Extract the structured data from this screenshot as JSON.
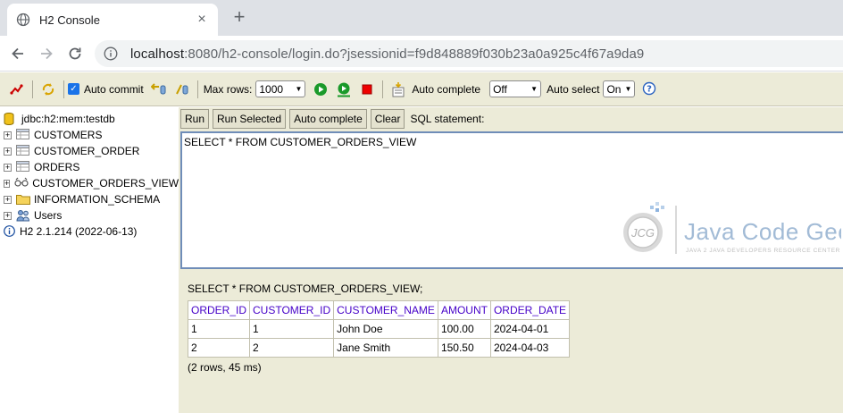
{
  "browser": {
    "tab_title": "H2 Console",
    "tab_close": "×",
    "new_tab": "+",
    "url_host": "localhost",
    "url_path": ":8080/h2-console/login.do?jsessionid=f9d848889f030b23a0a925c4f67a9da9"
  },
  "toolbar": {
    "auto_commit_label": "Auto commit",
    "max_rows_label": "Max rows:",
    "max_rows_value": "1000",
    "auto_complete_label": "Auto complete",
    "auto_complete_value": "Off",
    "auto_select_label": "Auto select",
    "auto_select_value": "On",
    "help_label": "?"
  },
  "tree": {
    "connection": "jdbc:h2:mem:testdb",
    "items": [
      {
        "label": "CUSTOMERS",
        "icon": "table-icon"
      },
      {
        "label": "CUSTOMER_ORDER",
        "icon": "table-icon"
      },
      {
        "label": "ORDERS",
        "icon": "table-icon"
      },
      {
        "label": "CUSTOMER_ORDERS_VIEW",
        "icon": "view-icon"
      },
      {
        "label": "INFORMATION_SCHEMA",
        "icon": "folder-icon"
      },
      {
        "label": "Users",
        "icon": "users-icon"
      }
    ],
    "version": "H2 2.1.214 (2022-06-13)"
  },
  "editor": {
    "run_label": "Run",
    "run_selected_label": "Run Selected",
    "auto_complete_label": "Auto complete",
    "clear_label": "Clear",
    "sql_statement_label": "SQL statement:",
    "sql_text": "SELECT * FROM CUSTOMER_ORDERS_VIEW"
  },
  "watermark": {
    "logo_text": "JCG",
    "brand": "Java Code Geeks",
    "tagline": "JAVA 2 JAVA DEVELOPERS RESOURCE CENTER"
  },
  "result": {
    "query": "SELECT * FROM CUSTOMER_ORDERS_VIEW;",
    "columns": [
      "ORDER_ID",
      "CUSTOMER_ID",
      "CUSTOMER_NAME",
      "AMOUNT",
      "ORDER_DATE"
    ],
    "rows": [
      [
        "1",
        "1",
        "John Doe",
        "100.00",
        "2024-04-01"
      ],
      [
        "2",
        "2",
        "Jane Smith",
        "150.50",
        "2024-04-03"
      ]
    ],
    "footer": "(2 rows, 45 ms)"
  },
  "colors": {
    "toolbar_bg": "#ecebd8",
    "header_text": "#4500c8",
    "sql_border": "#6f8db8"
  }
}
